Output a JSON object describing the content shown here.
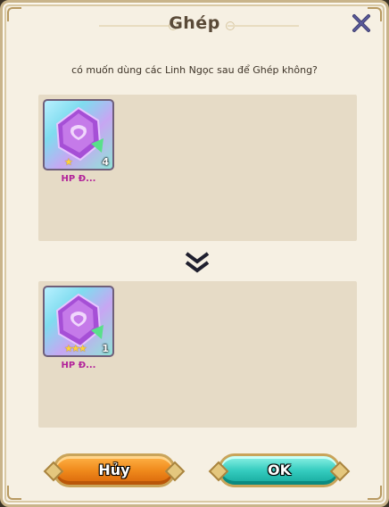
{
  "dialog": {
    "title": "Ghép",
    "prompt": "có muốn dùng các Linh Ngọc sau để Ghép không?"
  },
  "top_item": {
    "name": "HP Đ...",
    "count": "4",
    "stars": "★",
    "star_count": 1
  },
  "bottom_item": {
    "name": "HP Đ...",
    "count": "1",
    "stars": "★★★",
    "star_count": 3
  },
  "buttons": {
    "cancel_label": "Hủy",
    "ok_label": "OK"
  },
  "icons": {
    "close": "close-icon",
    "arrow": "double-chevron-down-icon",
    "item": "gem-icon"
  },
  "colors": {
    "cancel": "#f08a1c",
    "ok": "#35ccbf",
    "item_name": "#b2229a",
    "title": "#5a4a38"
  }
}
